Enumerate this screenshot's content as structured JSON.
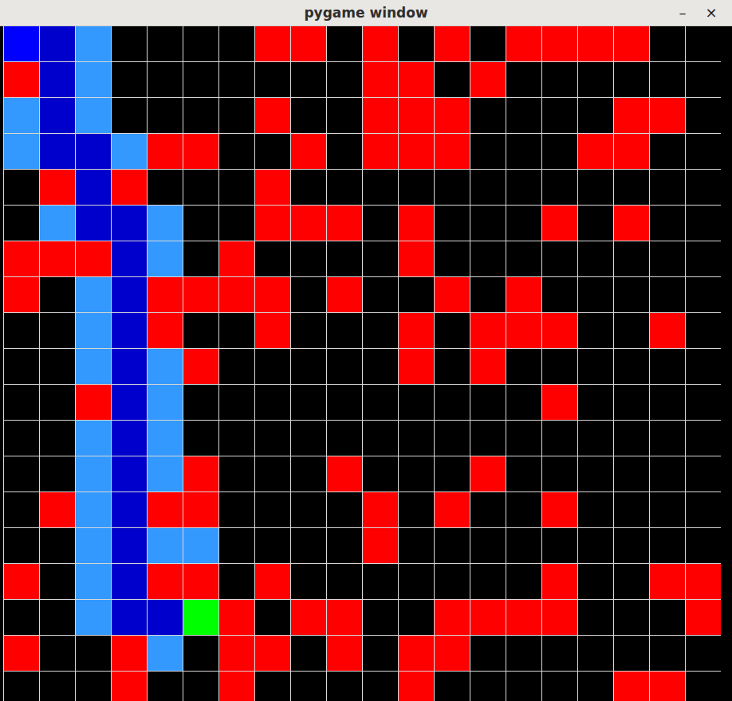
{
  "window": {
    "title": "pygame window",
    "buttons": [
      "–",
      "×"
    ]
  },
  "grid": {
    "rows": [
      [
        "start",
        "path",
        "visited",
        "empty",
        "empty",
        "empty",
        "empty",
        "wall",
        "wall",
        "empty",
        "wall",
        "empty",
        "wall",
        "empty",
        "wall",
        "wall",
        "wall",
        "wall",
        "empty",
        "empty"
      ],
      [
        "wall",
        "path",
        "visited",
        "empty",
        "empty",
        "empty",
        "empty",
        "empty",
        "empty",
        "empty",
        "wall",
        "wall",
        "empty",
        "wall",
        "empty",
        "empty",
        "empty",
        "empty",
        "empty",
        "empty"
      ],
      [
        "visited",
        "path",
        "visited",
        "empty",
        "empty",
        "empty",
        "empty",
        "wall",
        "empty",
        "empty",
        "wall",
        "wall",
        "wall",
        "empty",
        "empty",
        "empty",
        "empty",
        "wall",
        "wall",
        "empty"
      ],
      [
        "visited",
        "path",
        "path",
        "visited",
        "wall",
        "wall",
        "empty",
        "empty",
        "wall",
        "empty",
        "wall",
        "wall",
        "wall",
        "empty",
        "empty",
        "empty",
        "wall",
        "wall",
        "empty",
        "empty"
      ],
      [
        "empty",
        "wall",
        "path",
        "wall",
        "empty",
        "empty",
        "empty",
        "wall",
        "empty",
        "empty",
        "empty",
        "empty",
        "empty",
        "empty",
        "empty",
        "empty",
        "empty",
        "empty",
        "empty",
        "empty"
      ],
      [
        "empty",
        "visited",
        "path",
        "path",
        "visited",
        "empty",
        "empty",
        "wall",
        "wall",
        "wall",
        "empty",
        "wall",
        "empty",
        "empty",
        "empty",
        "wall",
        "empty",
        "wall",
        "empty",
        "empty"
      ],
      [
        "wall",
        "wall",
        "wall",
        "path",
        "visited",
        "empty",
        "wall",
        "empty",
        "empty",
        "empty",
        "empty",
        "wall",
        "empty",
        "empty",
        "empty",
        "empty",
        "empty",
        "empty",
        "empty",
        "empty"
      ],
      [
        "wall",
        "empty",
        "visited",
        "path",
        "wall",
        "wall",
        "wall",
        "wall",
        "empty",
        "wall",
        "empty",
        "empty",
        "wall",
        "empty",
        "wall",
        "empty",
        "empty",
        "empty",
        "empty",
        "empty"
      ],
      [
        "empty",
        "empty",
        "visited",
        "path",
        "wall",
        "empty",
        "empty",
        "wall",
        "empty",
        "empty",
        "empty",
        "wall",
        "empty",
        "wall",
        "wall",
        "wall",
        "empty",
        "empty",
        "wall",
        "empty"
      ],
      [
        "empty",
        "empty",
        "visited",
        "path",
        "visited",
        "wall",
        "empty",
        "empty",
        "empty",
        "empty",
        "empty",
        "wall",
        "empty",
        "wall",
        "empty",
        "empty",
        "empty",
        "empty",
        "empty",
        "empty"
      ],
      [
        "empty",
        "empty",
        "wall",
        "path",
        "visited",
        "empty",
        "empty",
        "empty",
        "empty",
        "empty",
        "empty",
        "empty",
        "empty",
        "empty",
        "empty",
        "wall",
        "empty",
        "empty",
        "empty",
        "empty"
      ],
      [
        "empty",
        "empty",
        "visited",
        "path",
        "visited",
        "empty",
        "empty",
        "empty",
        "empty",
        "empty",
        "empty",
        "empty",
        "empty",
        "empty",
        "empty",
        "empty",
        "empty",
        "empty",
        "empty",
        "empty"
      ],
      [
        "empty",
        "empty",
        "visited",
        "path",
        "visited",
        "wall",
        "empty",
        "empty",
        "empty",
        "wall",
        "empty",
        "empty",
        "empty",
        "wall",
        "empty",
        "empty",
        "empty",
        "empty",
        "empty",
        "empty"
      ],
      [
        "empty",
        "wall",
        "visited",
        "path",
        "wall",
        "wall",
        "empty",
        "empty",
        "empty",
        "empty",
        "wall",
        "empty",
        "wall",
        "empty",
        "empty",
        "wall",
        "empty",
        "empty",
        "empty",
        "empty"
      ],
      [
        "empty",
        "empty",
        "visited",
        "path",
        "visited",
        "visited",
        "empty",
        "empty",
        "empty",
        "empty",
        "wall",
        "empty",
        "empty",
        "empty",
        "empty",
        "empty",
        "empty",
        "empty",
        "empty",
        "empty"
      ],
      [
        "wall",
        "empty",
        "visited",
        "path",
        "wall",
        "wall",
        "empty",
        "wall",
        "empty",
        "empty",
        "empty",
        "empty",
        "empty",
        "empty",
        "empty",
        "wall",
        "empty",
        "empty",
        "wall",
        "wall"
      ],
      [
        "empty",
        "empty",
        "visited",
        "path",
        "path",
        "end",
        "wall",
        "empty",
        "wall",
        "wall",
        "empty",
        "empty",
        "wall",
        "wall",
        "wall",
        "wall",
        "empty",
        "empty",
        "empty",
        "wall"
      ],
      [
        "wall",
        "empty",
        "empty",
        "wall",
        "visited",
        "empty",
        "wall",
        "wall",
        "empty",
        "wall",
        "empty",
        "wall",
        "wall",
        "empty",
        "empty",
        "empty",
        "empty",
        "empty",
        "empty",
        "empty"
      ],
      [
        "empty",
        "empty",
        "empty",
        "wall",
        "empty",
        "empty",
        "wall",
        "empty",
        "empty",
        "empty",
        "empty",
        "wall",
        "empty",
        "empty",
        "empty",
        "empty",
        "empty",
        "wall",
        "wall",
        "empty"
      ]
    ]
  }
}
